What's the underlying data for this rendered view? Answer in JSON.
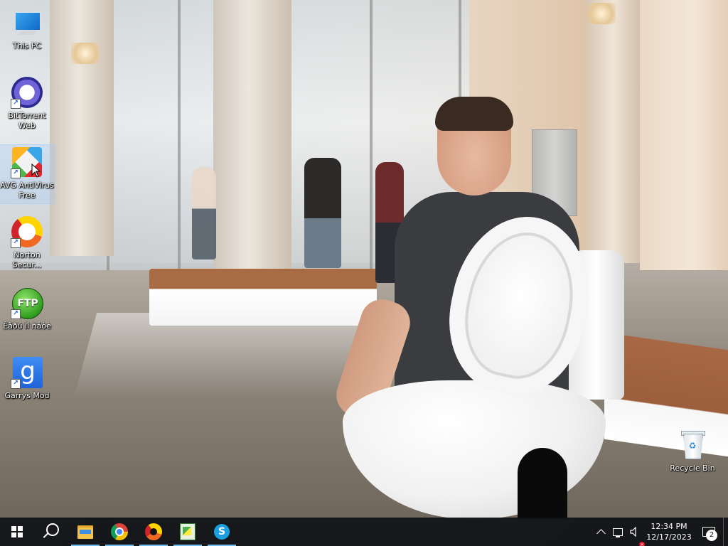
{
  "desktop": {
    "wallpaper_subject": "office-lobby-photo",
    "icons": [
      {
        "id": "this-pc",
        "label": "This PC",
        "icon": "computer-icon",
        "shortcut": false
      },
      {
        "id": "bittorrent",
        "label": "BitTorrent Web",
        "icon": "bittorrent-icon",
        "shortcut": true
      },
      {
        "id": "avg",
        "label": "AVG AntiVirus Free",
        "icon": "avg-icon",
        "shortcut": true,
        "selected": true
      },
      {
        "id": "norton",
        "label": "Norton Secur...",
        "icon": "norton-icon",
        "shortcut": true
      },
      {
        "id": "ftp",
        "label": "Êåðú ïî ñåòè",
        "icon": "ftp-icon",
        "shortcut": true,
        "glyph_text": "FTP"
      },
      {
        "id": "gmod",
        "label": "Garrys Mod",
        "icon": "gmod-icon",
        "shortcut": true,
        "glyph_text": "g"
      }
    ],
    "recycle_bin": {
      "label": "Recycle Bin",
      "icon": "recycle-bin-icon"
    }
  },
  "taskbar": {
    "buttons": [
      {
        "id": "start",
        "icon": "windows-start-icon"
      },
      {
        "id": "search",
        "icon": "search-icon"
      },
      {
        "id": "file-explorer",
        "icon": "folder-icon",
        "running": true
      },
      {
        "id": "chrome",
        "icon": "chrome-icon",
        "running": true
      },
      {
        "id": "norton",
        "icon": "norton-icon",
        "running": true
      },
      {
        "id": "spreadsheet",
        "icon": "spreadsheet-icon",
        "running": true
      },
      {
        "id": "skype",
        "icon": "skype-icon",
        "running": true,
        "glyph_text": "S"
      }
    ],
    "tray": {
      "overflow_icon": "chevron-up-icon",
      "network_icon": "network-icon",
      "volume_icon": "volume-muted-icon",
      "time": "12:34 PM",
      "date": "12/17/2023",
      "notification_icon": "notification-center-icon",
      "notification_count": "2"
    },
    "colors": {
      "background": "#101216",
      "active_indicator": "#76b9ed"
    }
  }
}
